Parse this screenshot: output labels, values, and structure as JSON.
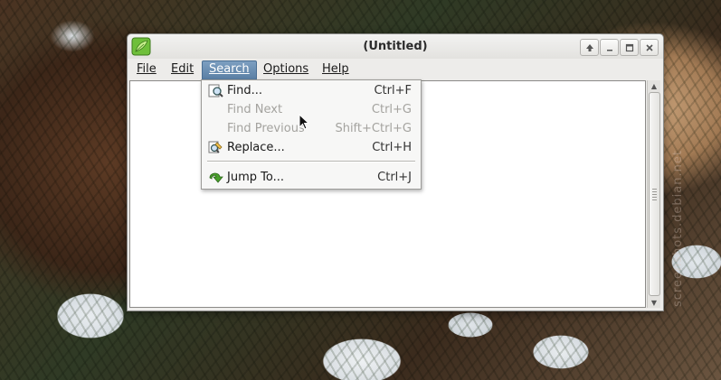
{
  "window": {
    "title": "(Untitled)",
    "controls": [
      "up-arrow-icon",
      "minimize-icon",
      "maximize-icon",
      "close-icon"
    ]
  },
  "menubar": {
    "items": [
      {
        "label": "File",
        "mnemonic": "F"
      },
      {
        "label": "Edit",
        "mnemonic": "E"
      },
      {
        "label": "Search",
        "mnemonic": "S",
        "active": true
      },
      {
        "label": "Options",
        "mnemonic": "O"
      },
      {
        "label": "Help",
        "mnemonic": "H"
      }
    ]
  },
  "search_menu": {
    "items": [
      {
        "label": "Find...",
        "accel": "Ctrl+F",
        "enabled": true,
        "icon": "find-icon"
      },
      {
        "label": "Find Next",
        "accel": "Ctrl+G",
        "enabled": false
      },
      {
        "label": "Find Previous",
        "accel": "Shift+Ctrl+G",
        "enabled": false
      },
      {
        "label": "Replace...",
        "accel": "Ctrl+H",
        "enabled": true,
        "icon": "replace-icon"
      },
      {
        "label": "Jump To...",
        "accel": "Ctrl+J",
        "enabled": true,
        "icon": "jump-icon"
      }
    ]
  },
  "editor": {
    "content": ""
  },
  "watermark": "screenshots.debian.net",
  "colors": {
    "menu_active_bg": "#5a7fa4",
    "window_bg": "#edecea",
    "disabled_text": "#a4a39f"
  }
}
